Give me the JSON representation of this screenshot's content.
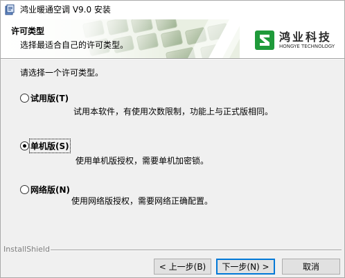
{
  "window": {
    "title": "鸿业暖通空调 V9.0 安装"
  },
  "header": {
    "title": "许可类型",
    "subtitle": "选择最适合自己的许可类型。",
    "logo_cn": "鸿业科技",
    "logo_en": "HONGYE TECHNOLOGY"
  },
  "body": {
    "prompt": "请选择一个许可类型。",
    "options": [
      {
        "label": "试用版(T)",
        "description": "试用本软件，有使用次数限制，功能上与正式版相同。",
        "selected": false
      },
      {
        "label": "单机版(S)",
        "description": "使用单机版授权，需要单机加密锁。",
        "selected": true
      },
      {
        "label": "网络版(N)",
        "description": "使用网络版授权，需要网络正确配置。",
        "selected": false
      }
    ]
  },
  "footer": {
    "brand": "InstallShield",
    "back_label": "< 上一步(B)",
    "next_label": "下一步(N) >",
    "cancel_label": "取消"
  },
  "colors": {
    "accent": "#0078d7",
    "logo_green": "#1f9a3a"
  }
}
